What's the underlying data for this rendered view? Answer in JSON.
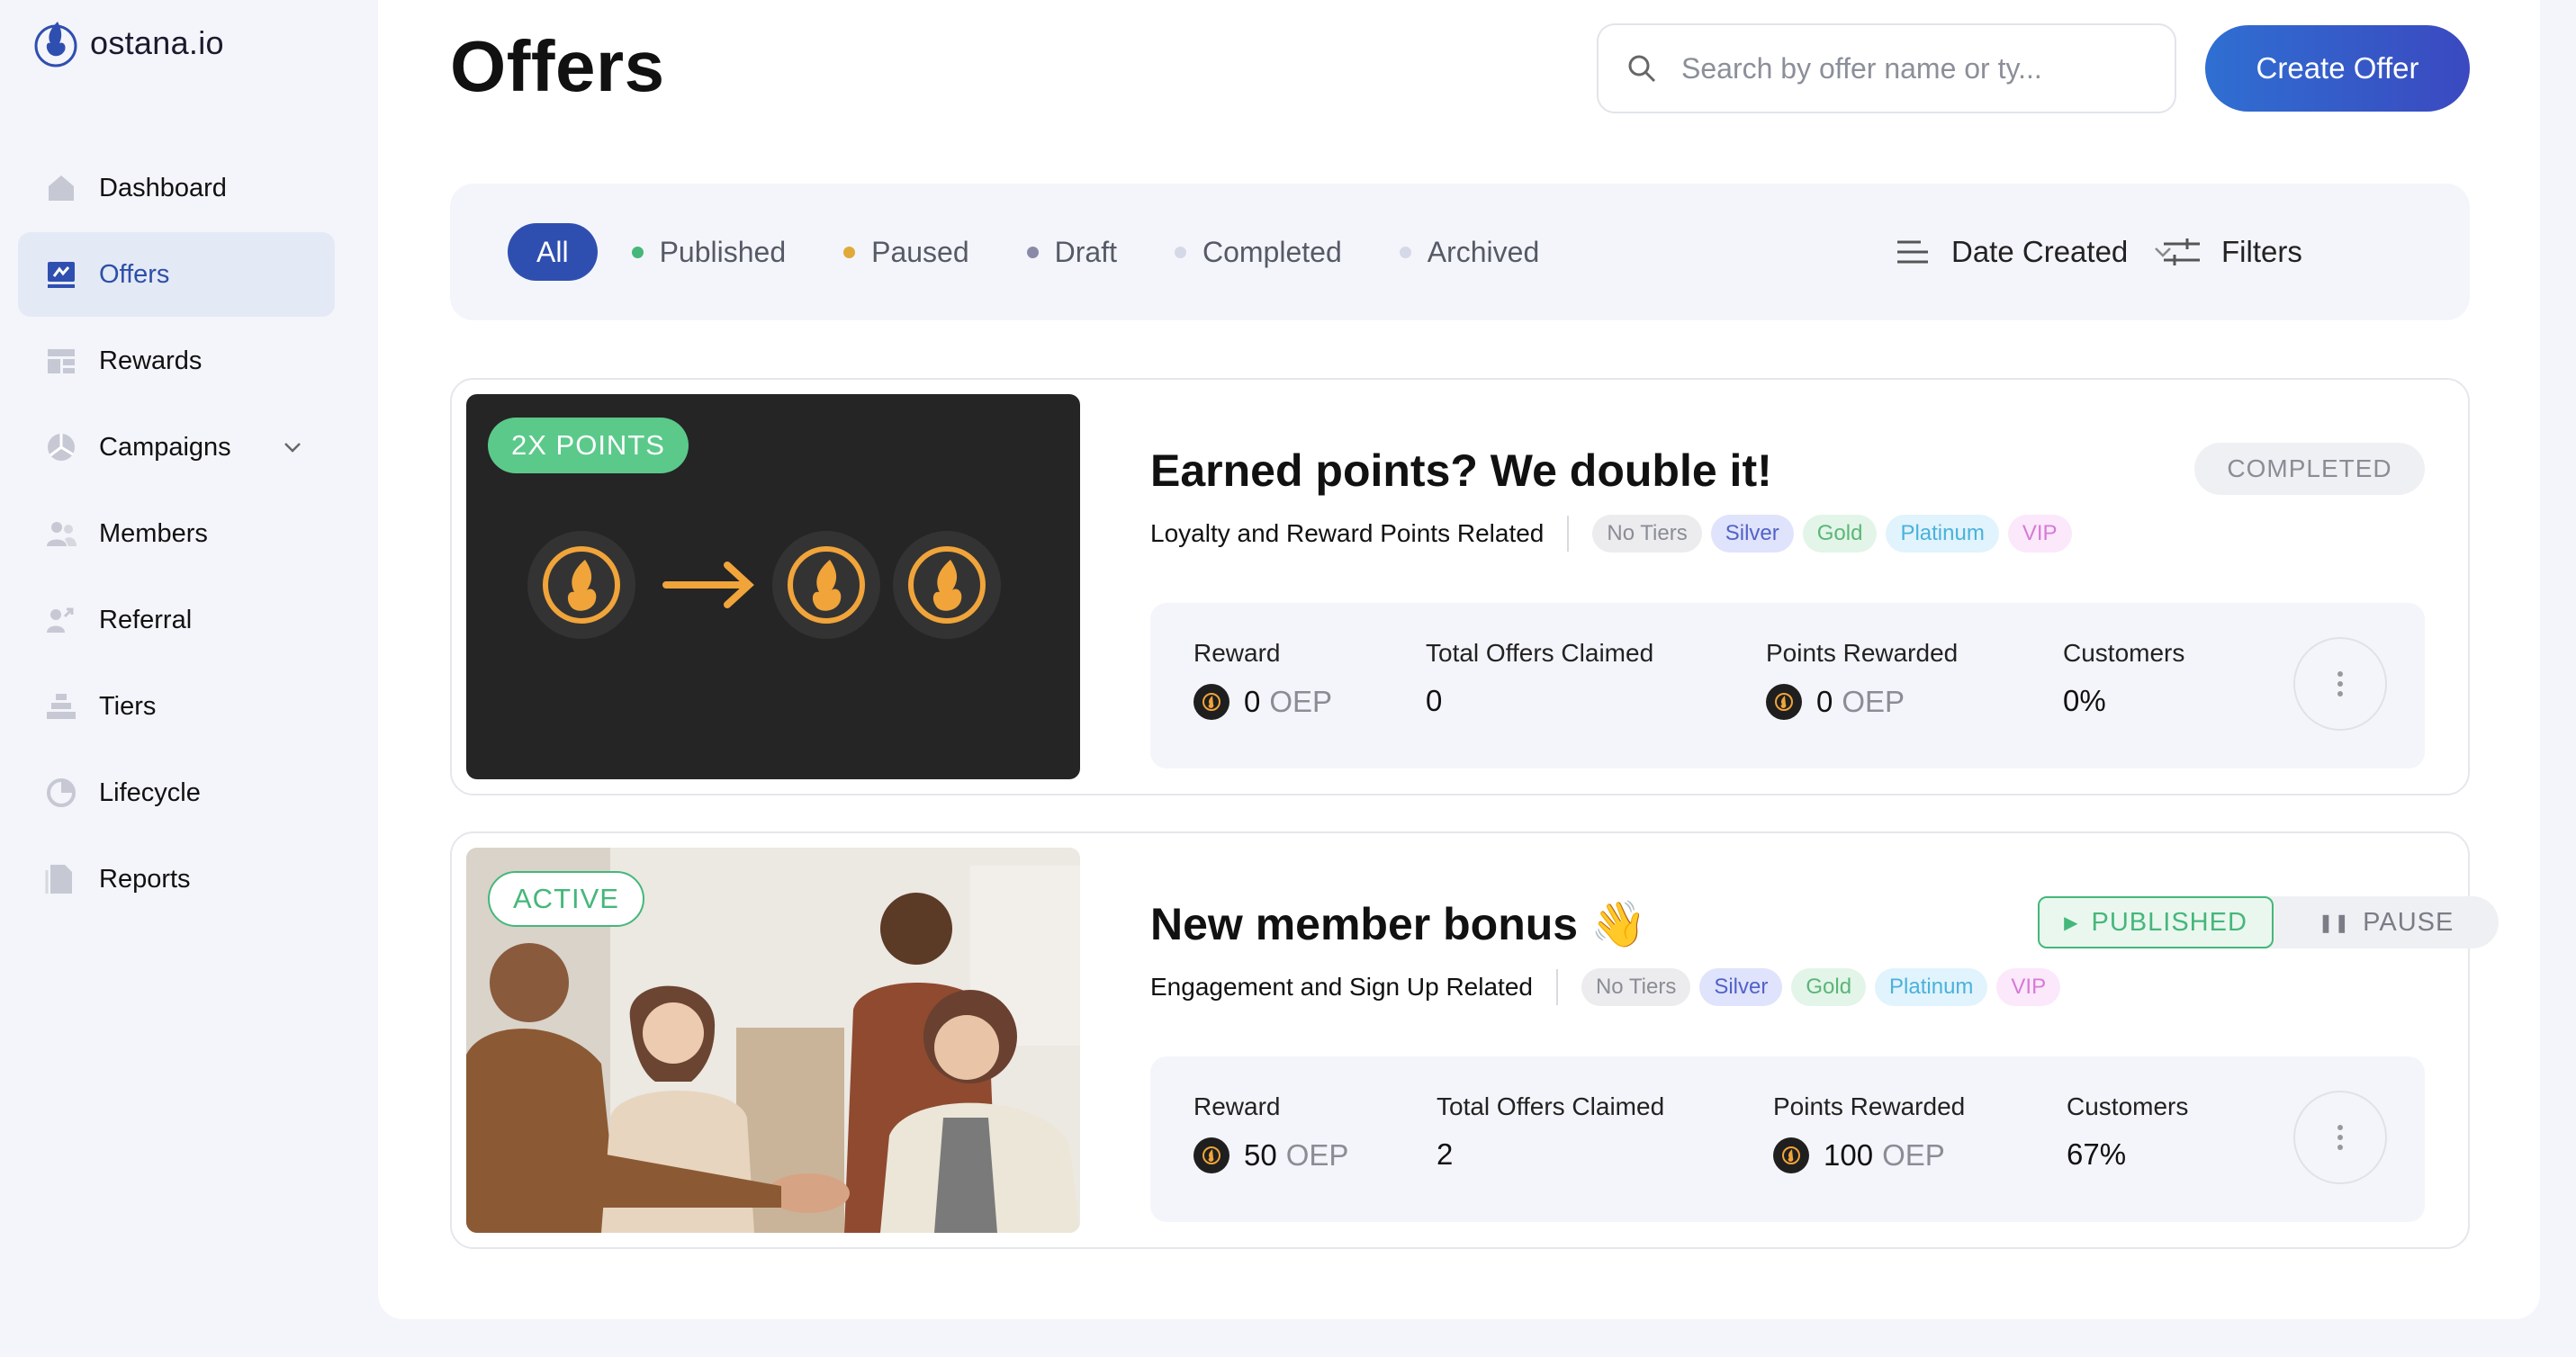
{
  "app": {
    "name": "ostana.io"
  },
  "sidebar": {
    "items": [
      {
        "label": "Dashboard",
        "icon": "home-icon"
      },
      {
        "label": "Offers",
        "icon": "offers-icon",
        "active": true
      },
      {
        "label": "Rewards",
        "icon": "rewards-icon"
      },
      {
        "label": "Campaigns",
        "icon": "campaigns-icon",
        "has_chevron": true
      },
      {
        "label": "Members",
        "icon": "members-icon"
      },
      {
        "label": "Referral",
        "icon": "referral-icon"
      },
      {
        "label": "Tiers",
        "icon": "tiers-icon"
      },
      {
        "label": "Lifecycle",
        "icon": "lifecycle-icon"
      },
      {
        "label": "Reports",
        "icon": "reports-icon"
      }
    ]
  },
  "header": {
    "title": "Offers",
    "search_placeholder": "Search by offer name or ty...",
    "create_label": "Create Offer"
  },
  "filters": {
    "tabs": [
      {
        "label": "All",
        "dot_color": null
      },
      {
        "label": "Published",
        "dot_color": "#45b77a"
      },
      {
        "label": "Paused",
        "dot_color": "#e0a93a"
      },
      {
        "label": "Draft",
        "dot_color": "#8a8aa8"
      },
      {
        "label": "Completed",
        "dot_color": "#d5d8e6"
      },
      {
        "label": "Archived",
        "dot_color": "#d5d8e6"
      }
    ],
    "sort_label": "Date Created",
    "filters_label": "Filters"
  },
  "offers": [
    {
      "badge": "2X POINTS",
      "title": "Earned points? We double it!",
      "category": "Loyalty and Reward Points Related",
      "tiers": [
        "No Tiers",
        "Silver",
        "Gold",
        "Platinum",
        "VIP"
      ],
      "status": "COMPLETED",
      "stats": {
        "reward_label": "Reward",
        "reward_value": "0",
        "reward_unit": "OEP",
        "claimed_label": "Total Offers Claimed",
        "claimed_value": "0",
        "points_label": "Points Rewarded",
        "points_value": "0",
        "points_unit": "OEP",
        "customers_label": "Customers",
        "customers_value": "0%"
      }
    },
    {
      "badge": "ACTIVE",
      "title": "New member bonus 👋",
      "category": "Engagement and Sign Up Related",
      "tiers": [
        "No Tiers",
        "Silver",
        "Gold",
        "Platinum",
        "VIP"
      ],
      "status": "PUBLISHED",
      "status_action": "PAUSE",
      "stats": {
        "reward_label": "Reward",
        "reward_value": "50",
        "reward_unit": "OEP",
        "claimed_label": "Total Offers Claimed",
        "claimed_value": "2",
        "points_label": "Points Rewarded",
        "points_value": "100",
        "points_unit": "OEP",
        "customers_label": "Customers",
        "customers_value": "67%"
      }
    }
  ],
  "colors": {
    "accent": "#2f4fb0",
    "published": "#45b77a",
    "coin": "#f0a43a"
  }
}
